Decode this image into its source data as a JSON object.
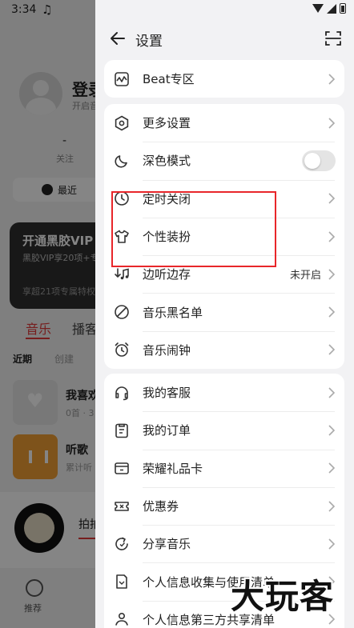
{
  "status_bar": {
    "time": "3:34"
  },
  "background": {
    "login_title": "登录",
    "login_subtitle": "开启音",
    "follow_count": "-",
    "follow_label": "关注",
    "recent_chip": "最近",
    "vip_title": "开通黑胶VIP",
    "vip_subtitle": "黑胶VIP享20项+专",
    "vip_footer": "享超21项专属特权",
    "tab_music": "音乐",
    "tab_podcast": "播客",
    "sub_recent": "近期",
    "sub_create": "创建",
    "liked_title": "我喜欢",
    "liked_sub": "0首 · 3",
    "listen_title": "听歌",
    "listen_sub": "累计听",
    "player_title": "拍拍",
    "nav_recommend": "推荐"
  },
  "header": {
    "title": "设置"
  },
  "sections": [
    {
      "items": [
        {
          "label": "Beat专区",
          "icon": "beat-icon"
        }
      ]
    },
    {
      "items": [
        {
          "label": "更多设置",
          "icon": "hexagon-settings-icon"
        },
        {
          "label": "深色模式",
          "icon": "moon-icon",
          "toggle": false
        },
        {
          "label": "定时关闭",
          "icon": "clock-icon"
        },
        {
          "label": "个性装扮",
          "icon": "tshirt-icon"
        },
        {
          "label": "边听边存",
          "icon": "download-music-icon",
          "value": "未开启"
        },
        {
          "label": "音乐黑名单",
          "icon": "blocked-icon"
        },
        {
          "label": "音乐闹钟",
          "icon": "alarm-icon"
        }
      ]
    },
    {
      "items": [
        {
          "label": "我的客服",
          "icon": "headset-icon"
        },
        {
          "label": "我的订单",
          "icon": "order-icon"
        },
        {
          "label": "荣耀礼品卡",
          "icon": "gift-card-icon"
        },
        {
          "label": "优惠券",
          "icon": "coupon-icon"
        },
        {
          "label": "分享音乐",
          "icon": "share-icon"
        },
        {
          "label": "个人信息收集与使用清单",
          "icon": "document-icon"
        },
        {
          "label": "个人信息第三方共享清单",
          "icon": "share-people-icon"
        }
      ]
    }
  ],
  "watermark": "大玩客",
  "colors": {
    "highlight": "#e8262a",
    "accent": "#e23a3a"
  }
}
